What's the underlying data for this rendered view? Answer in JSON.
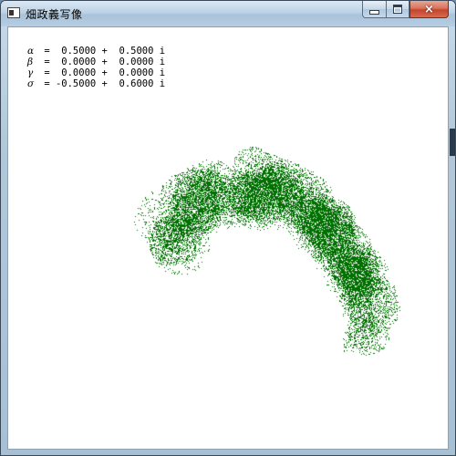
{
  "window": {
    "title": "畑政義写像",
    "buttons": {
      "minimize": "minimize",
      "maximize": "maximize",
      "close": "×"
    }
  },
  "parameters": [
    {
      "symbol": "α",
      "value": " =  0.5000 +  0.5000 i"
    },
    {
      "symbol": "β",
      "value": " =  0.0000 +  0.0000 i"
    },
    {
      "symbol": "γ",
      "value": " =  0.0000 +  0.0000 i"
    },
    {
      "symbol": "σ",
      "value": " = -0.5000 +  0.6000 i"
    }
  ],
  "plot": {
    "color": "#007000",
    "background": "#ffffff"
  }
}
